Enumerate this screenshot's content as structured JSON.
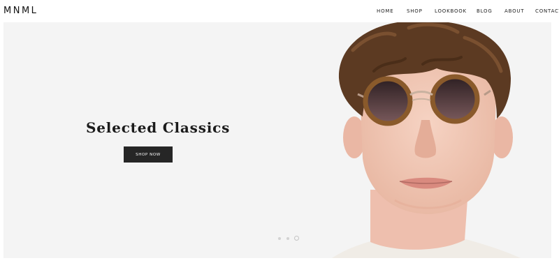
{
  "brand": {
    "logo": "MNML"
  },
  "nav": {
    "items": [
      {
        "label": "HOME"
      },
      {
        "label": "SHOP"
      },
      {
        "label": "LOOKBOOK"
      },
      {
        "label": "BLOG"
      },
      {
        "label": "ABOUT"
      },
      {
        "label": "CONTACT"
      }
    ]
  },
  "hero": {
    "title": "Selected Classics",
    "cta_label": "SHOP NOW",
    "slider": {
      "slide_count": 3,
      "active_index": 2
    }
  },
  "colors": {
    "background": "#ffffff",
    "hero_background": "#f4f4f4",
    "button": "#262626",
    "button_text": "#ffffff",
    "text": "#1a1a1a"
  }
}
